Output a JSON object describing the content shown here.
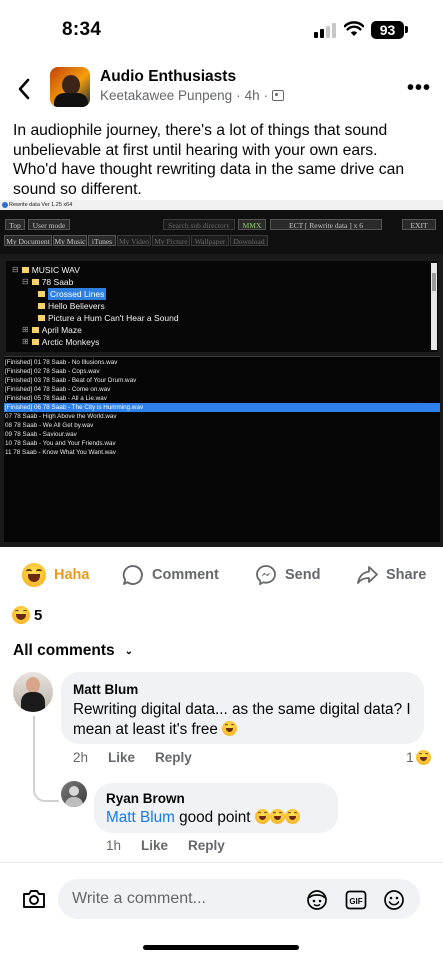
{
  "status_bar": {
    "time": "8:34",
    "battery": "93"
  },
  "post": {
    "group_name": "Audio Enthusiasts",
    "author": "Keetakawee Punpeng",
    "time": "4h",
    "text": "In audiophile journey, there's a lot of things that sound unbelievable at first until hearing with your own ears. Who'd have thought rewriting data in the same drive can sound so different."
  },
  "embedded_app": {
    "title": "Rewrite data  Ver 1.25 x64",
    "toolbar_row1": [
      "Top",
      "User mode",
      "Search sub directory",
      "MMX",
      "ECT [ Rewrite data ] x 6",
      "EXIT"
    ],
    "toolbar_row2": [
      "My Document",
      "My Music",
      "iTunes",
      "My Video",
      "My Picture",
      "Wallpaper",
      "Download"
    ],
    "tree": {
      "root": "MUSIC WAV",
      "album": "78 Saab",
      "album_items": [
        "Crossed Lines",
        "Hello Believers",
        "Picture a Hum Can't Hear a Sound"
      ],
      "others": [
        "April Maze",
        "Arctic Monkeys"
      ]
    },
    "files": [
      "[Finished] 01 78 Saab - No Illusions.wav",
      "[Finished] 02 78 Saab - Cops.wav",
      "[Finished] 03 78 Saab - Beat of Your Drum.wav",
      "[Finished] 04 78 Saab - Come on.wav",
      "[Finished] 05 78 Saab - All a Lie.wav",
      "[Finished] 06 78 Saab - The City is Humming.wav",
      "07 78 Saab - High Above the World.wav",
      "08 78 Saab - We All Get by.wav",
      "09 78 Saab - Saviour.wav",
      "10 78 Saab - You and Your Friends.wav",
      "11 78 Saab - Know What You Want.wav"
    ]
  },
  "actions": {
    "haha": "Haha",
    "comment": "Comment",
    "send": "Send",
    "share": "Share"
  },
  "reaction_count": "5",
  "comments_filter": "All comments",
  "comments": [
    {
      "author": "Matt Blum",
      "text": "Rewriting digital data... as the same digital data? I mean at least it's free",
      "time": "2h",
      "like": "Like",
      "reply": "Reply",
      "reaction_count": "1"
    },
    {
      "author": "Ryan Brown",
      "mention": "Matt Blum",
      "text": "good point",
      "time": "1h",
      "like": "Like",
      "reply": "Reply"
    }
  ],
  "composer": {
    "placeholder": "Write a comment..."
  },
  "colors": {
    "link": "#1877f2",
    "haha": "#e89a1c",
    "secondary_text": "#65676b",
    "bubble": "#f0f2f5"
  }
}
